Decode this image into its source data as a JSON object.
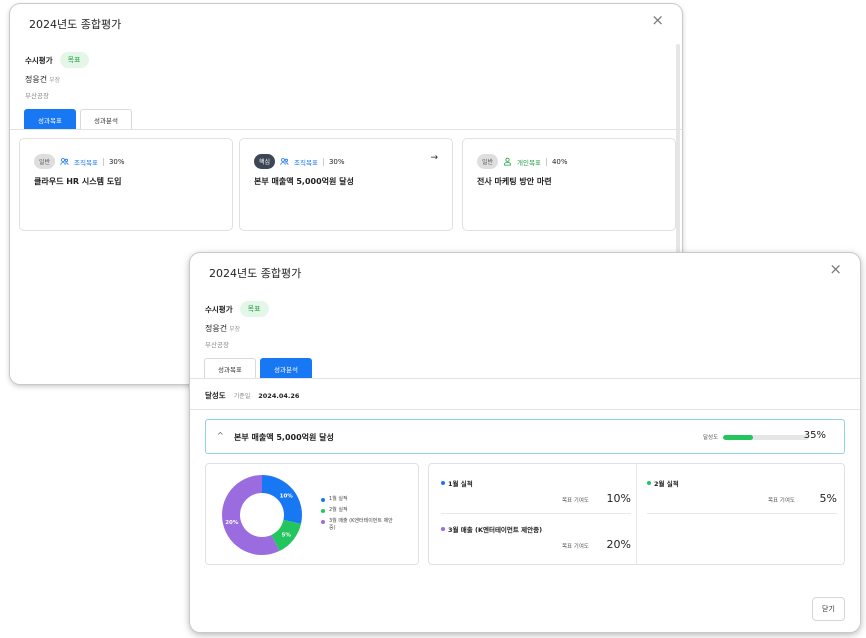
{
  "common": {
    "modal_title": "2024년도 종합평가",
    "close_symbol": "×",
    "eval_label": "수시평가",
    "eval_badge": "목표",
    "person_name": "정응건",
    "person_rank": "부장",
    "department": "부산공장",
    "tabs": [
      "성과목표",
      "성과분석"
    ]
  },
  "back_modal": {
    "active_tab": "성과목표",
    "goals": [
      {
        "priority": "일반",
        "type": "조직목표",
        "type_icon": "org-people-icon",
        "weight": "30%",
        "title": "클라우드 HR 시스템 도입",
        "arrow": ""
      },
      {
        "priority": "핵심",
        "type": "조직목표",
        "type_icon": "org-people-icon",
        "weight": "30%",
        "title": "본부 매출액 5,000억원 달성",
        "arrow": "→"
      },
      {
        "priority": "일반",
        "type": "개인목표",
        "type_icon": "person-icon",
        "weight": "40%",
        "title": "전사 마케팅 방안 마련",
        "arrow": ""
      }
    ]
  },
  "front_modal": {
    "active_tab": "성과분석",
    "achievement_title": "달성도",
    "base_date_label": "기준일",
    "base_date": "2024.04.26",
    "accordion": {
      "chevron": "^",
      "title": "본부 매출액 5,000억원 달성",
      "progress_label": "달성도",
      "progress_pct": "35%",
      "progress_value": 0.35,
      "bar_color": "#22c55e"
    },
    "donut": {
      "segments": [
        {
          "label": "1월 실적",
          "value": 10,
          "display": "10%",
          "color": "#1877f2"
        },
        {
          "label": "2월 실적",
          "value": 5,
          "display": "5%",
          "color": "#22c55e"
        },
        {
          "label": "3월 매출 (K엔터테이먼트 제안중)",
          "value": 20,
          "display": "20%",
          "color": "#9b6be0"
        }
      ]
    },
    "metrics": [
      {
        "name": "1월 실적",
        "color": "#1877f2",
        "contribution_label": "목표 기여도",
        "value": "10%"
      },
      {
        "name": "2월 실적",
        "color": "#22c55e",
        "contribution_label": "목표 기여도",
        "value": "5%"
      },
      {
        "name": "3월 매출 (K엔터테이먼트 제안중)",
        "color": "#9b6be0",
        "contribution_label": "목표 기여도",
        "value": "20%"
      }
    ],
    "close_button": "닫기"
  }
}
